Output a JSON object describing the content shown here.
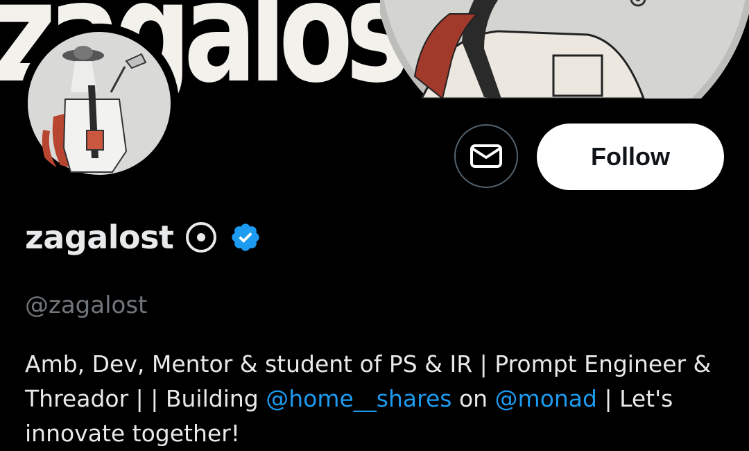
{
  "banner": {
    "text": "zagalos"
  },
  "header": {
    "message_icon": "envelope-icon",
    "follow_label": "Follow"
  },
  "profile": {
    "display_name": "zagalost",
    "status_icon": "target-icon",
    "verified_icon": "verified-badge-icon",
    "handle": "@zagalost",
    "bio": {
      "part1": "Amb, Dev, Mentor & student of PS & IR | Prompt Engineer & Threador |  | Building ",
      "mention1": "@home__shares",
      "part2": " on ",
      "mention2": "@monad",
      "part3": " | Let's innovate together!"
    }
  },
  "colors": {
    "background": "#000000",
    "accent": "#1d9bf0",
    "secondary_text": "#71767b",
    "primary_text": "#e7e9ea"
  }
}
